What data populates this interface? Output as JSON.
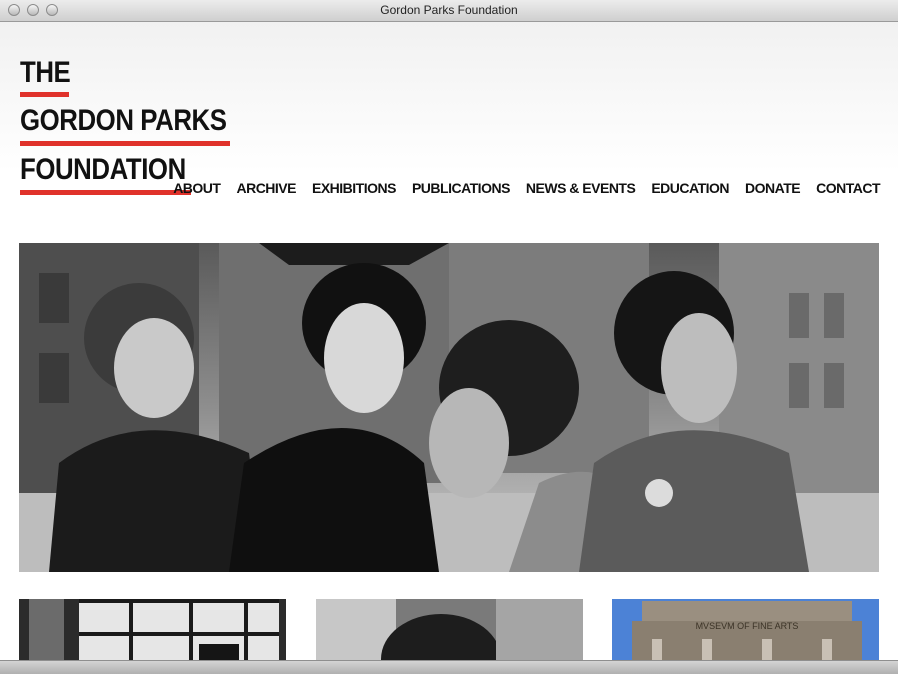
{
  "window": {
    "title": "Gordon Parks Foundation"
  },
  "logo": {
    "line1": "THE",
    "line2": "GORDON PARKS",
    "line3": "FOUNDATION",
    "accent_color": "#e0322b"
  },
  "nav": {
    "items": [
      {
        "label": "ABOUT"
      },
      {
        "label": "ARCHIVE"
      },
      {
        "label": "EXHIBITIONS"
      },
      {
        "label": "PUBLICATIONS"
      },
      {
        "label": "NEWS & EVENTS"
      },
      {
        "label": "EDUCATION"
      },
      {
        "label": "DONATE"
      },
      {
        "label": "CONTACT"
      }
    ]
  },
  "thumbnails": {
    "museum_sign": "MVSEVM OF FINE ARTS"
  }
}
